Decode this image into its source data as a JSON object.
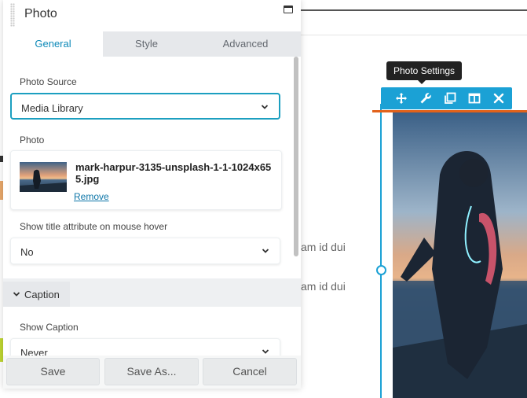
{
  "panel": {
    "title": "Photo",
    "tabs": [
      {
        "label": "General",
        "active": true
      },
      {
        "label": "Style",
        "active": false
      },
      {
        "label": "Advanced",
        "active": false
      }
    ],
    "fields": {
      "photo_source": {
        "label": "Photo Source",
        "value": "Media Library"
      },
      "photo": {
        "label": "Photo",
        "file_name": "mark-harpur-3135-unsplash-1-1-1024x655.jpg",
        "remove_label": "Remove"
      },
      "show_title": {
        "label": "Show title attribute on mouse hover",
        "value": "No"
      },
      "show_caption": {
        "label": "Show Caption",
        "value": "Never"
      }
    },
    "caption_section": {
      "label": "Caption",
      "expanded": true
    },
    "footer": {
      "save_label": "Save",
      "save_as_label": "Save As...",
      "cancel_label": "Cancel"
    }
  },
  "toolbar": {
    "tooltip": "Photo Settings",
    "buttons": [
      {
        "name": "move",
        "icon": "move-icon"
      },
      {
        "name": "settings",
        "icon": "wrench-icon"
      },
      {
        "name": "duplicate",
        "icon": "duplicate-icon"
      },
      {
        "name": "columns",
        "icon": "columns-icon"
      },
      {
        "name": "remove",
        "icon": "close-icon"
      }
    ]
  },
  "page": {
    "text_fragments": [
      "am id dui",
      "am id dui"
    ]
  },
  "colors": {
    "accent": "#1ba1d5",
    "tab_active_text": "#0e8ab8",
    "drop_indicator": "#e2621b",
    "link": "#0e76a8"
  }
}
